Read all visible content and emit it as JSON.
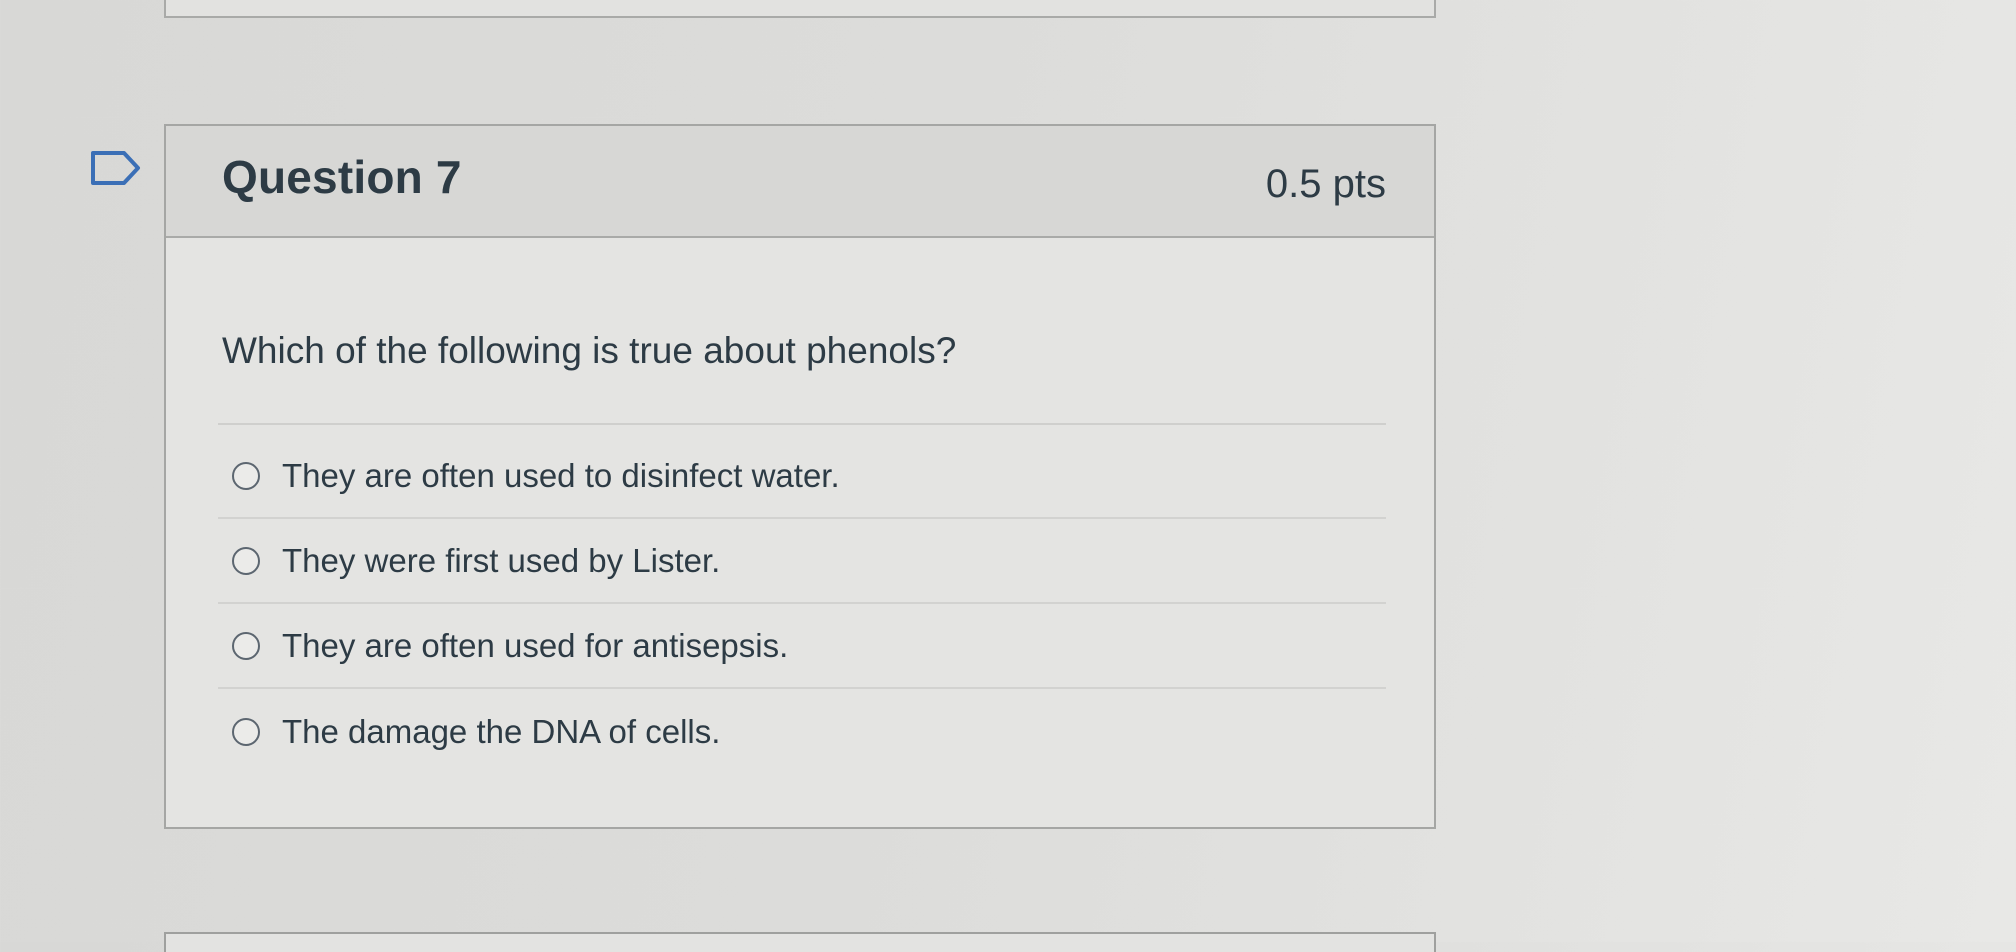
{
  "question": {
    "title": "Question 7",
    "points": "0.5 pts",
    "text": "Which of the following is true about phenols?",
    "flag_icon": "flag-outline-icon",
    "options": [
      {
        "label": "They are often used to disinfect water.",
        "selected": false
      },
      {
        "label": "They were first used by Lister.",
        "selected": false
      },
      {
        "label": "They are often used for antisepsis.",
        "selected": false
      },
      {
        "label": "The damage the DNA of cells.",
        "selected": false
      }
    ]
  },
  "colors": {
    "text": "#2d3b45",
    "header_bg": "#d7d7d5",
    "border": "#a5a6a4"
  }
}
